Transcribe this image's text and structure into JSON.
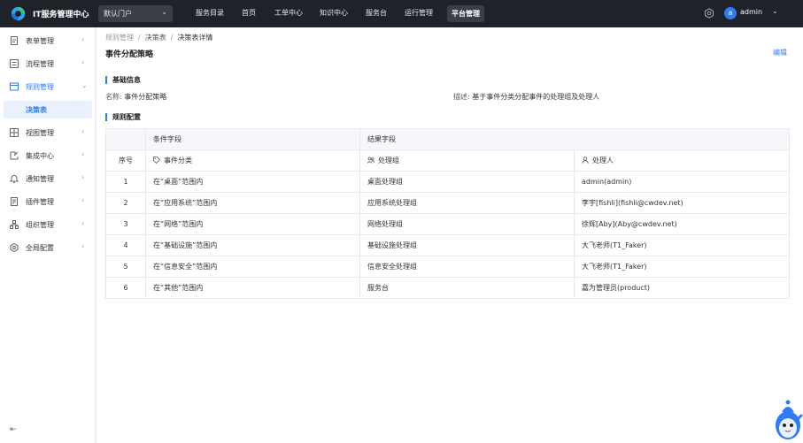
{
  "header": {
    "app_title": "IT服务管理中心",
    "portal_select": "默认门户",
    "nav": [
      "服务目录",
      "首页",
      "工单中心",
      "知识中心",
      "服务台",
      "运行管理",
      "平台管理"
    ],
    "active_nav": "平台管理",
    "user": {
      "avatar_letter": "a",
      "name": "admin"
    }
  },
  "sidebar": {
    "items": [
      {
        "label": "表单管理",
        "icon": "form-icon"
      },
      {
        "label": "流程管理",
        "icon": "flow-icon"
      },
      {
        "label": "规则管理",
        "icon": "rules-icon",
        "expanded": true
      },
      {
        "label": "视图管理",
        "icon": "view-icon"
      },
      {
        "label": "集成中心",
        "icon": "integration-icon"
      },
      {
        "label": "通知管理",
        "icon": "bell-icon"
      },
      {
        "label": "插件管理",
        "icon": "plugin-icon"
      },
      {
        "label": "组织管理",
        "icon": "org-icon"
      },
      {
        "label": "全局配置",
        "icon": "settings-icon"
      }
    ],
    "active_sub": "决策表"
  },
  "breadcrumb": [
    "规则管理",
    "决策表",
    "决策表详情"
  ],
  "page": {
    "title": "事件分配策略",
    "edit_label": "编辑",
    "basic_info_title": "基础信息",
    "name_label": "名称:",
    "name_value": "事件分配策略",
    "desc_label": "描述:",
    "desc_value": "基于事件分类分配事件的处理组及处理人",
    "rules_title": "规则配置"
  },
  "table": {
    "group_headers": {
      "condition": "条件字段",
      "result": "结果字段"
    },
    "columns": [
      "序号",
      "事件分类",
      "处理组",
      "处理人"
    ],
    "rows": [
      [
        "1",
        "在“桌面”范围内",
        "桌面处理组",
        "admin(admin)"
      ],
      [
        "2",
        "在“应用系统”范围内",
        "应用系统处理组",
        "李宇[fishli](fishli@cwdev.net)"
      ],
      [
        "3",
        "在“网络”范围内",
        "网络处理组",
        "徐辉[Aby](Aby@cwdev.net)"
      ],
      [
        "4",
        "在“基础设施”范围内",
        "基础设施处理组",
        "大飞老师(T1_Faker)"
      ],
      [
        "5",
        "在“信息安全”范围内",
        "信息安全处理组",
        "大飞老师(T1_Faker)"
      ],
      [
        "6",
        "在“其他”范围内",
        "服务台",
        "嘉为管理员(product)"
      ]
    ]
  },
  "colors": {
    "accent": "#2f7bf5",
    "topbar": "#1f2329"
  }
}
